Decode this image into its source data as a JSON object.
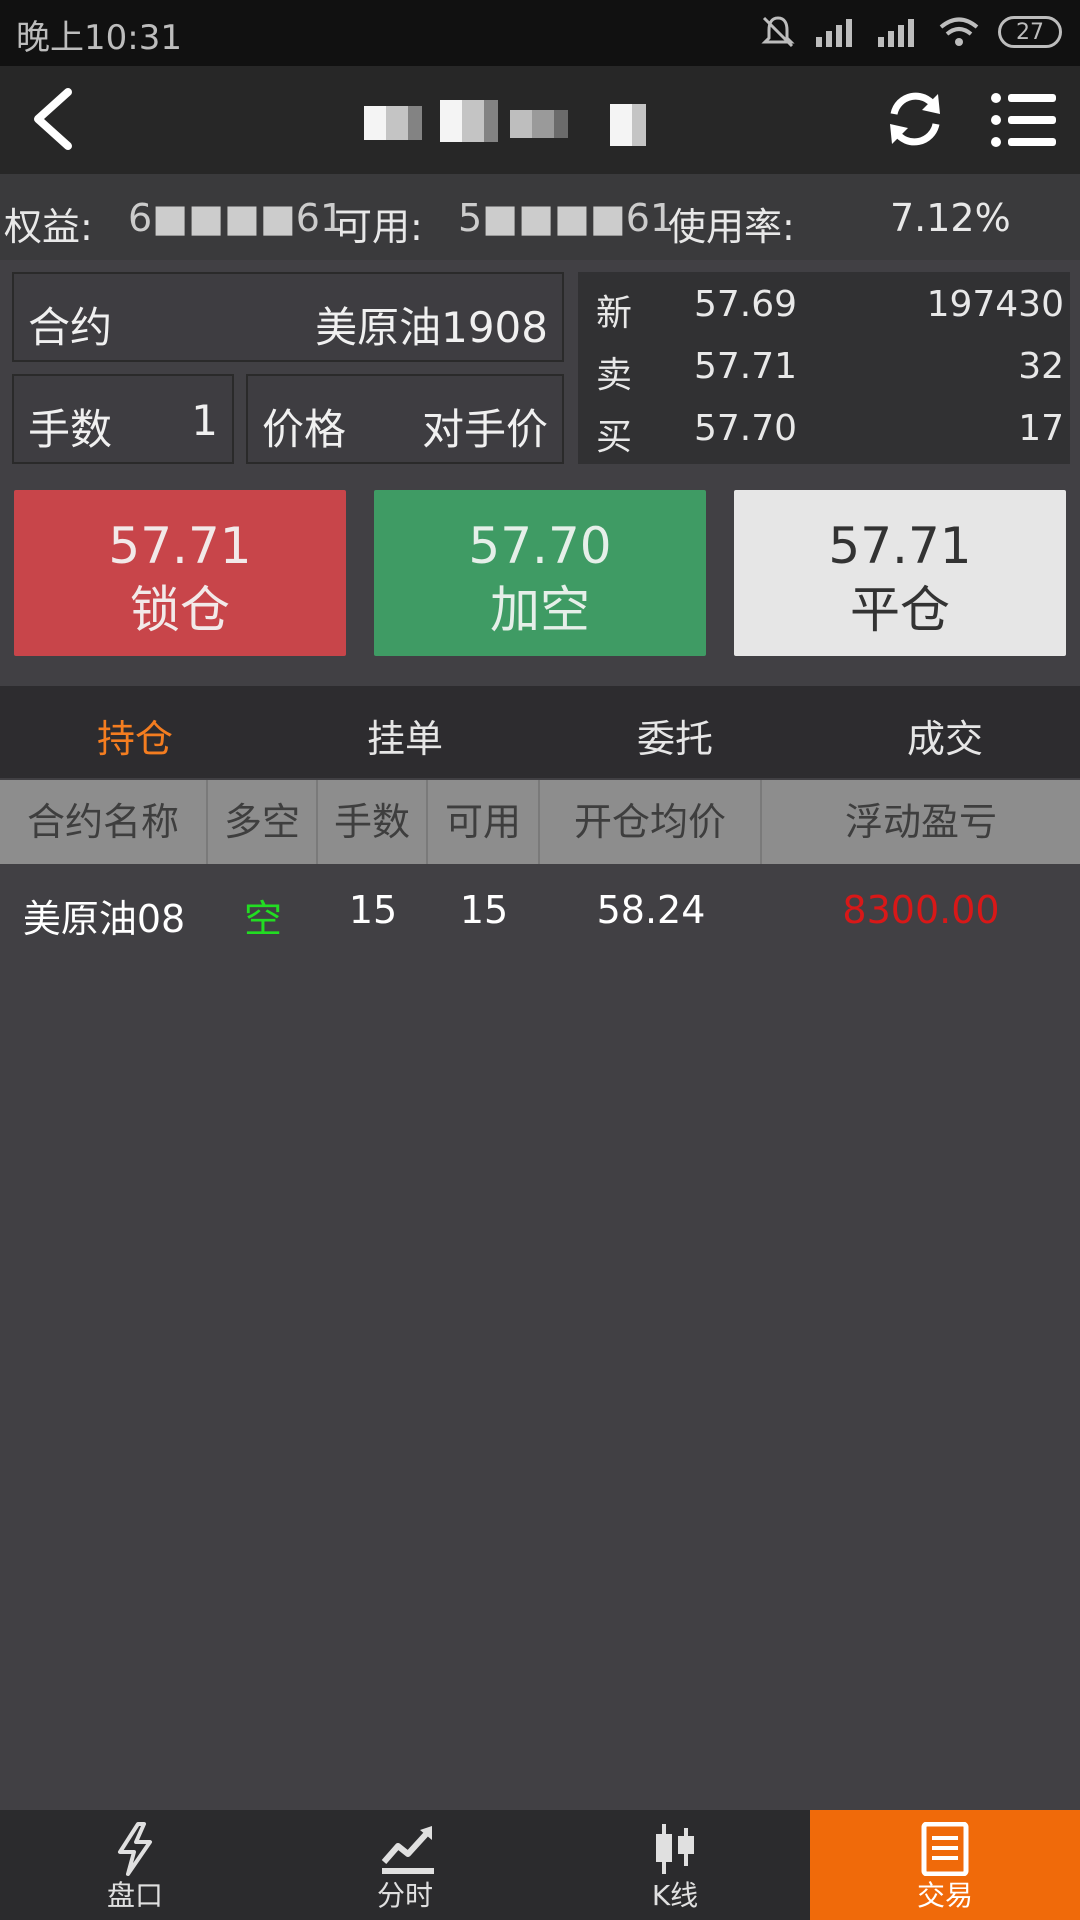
{
  "status_bar": {
    "time": "晚上10:31",
    "battery": "27"
  },
  "account": {
    "equity_label": "权益:",
    "equity_value": "6■■■■61",
    "available_label": "可用:",
    "available_value": "5■■■■61",
    "usage_label": "使用率:",
    "usage_value": "7.12%"
  },
  "order_form": {
    "contract_label": "合约",
    "contract_value": "美原油1908",
    "lots_label": "手数",
    "lots_value": "1",
    "price_label": "价格",
    "price_value": "对手价"
  },
  "quote": {
    "rows": [
      {
        "label": "新",
        "price": "57.69",
        "volume": "197430"
      },
      {
        "label": "卖",
        "price": "57.71",
        "volume": "32"
      },
      {
        "label": "买",
        "price": "57.70",
        "volume": "17"
      }
    ]
  },
  "actions": {
    "lock": {
      "price": "57.71",
      "label": "锁仓",
      "color": "#c8454a"
    },
    "short": {
      "price": "57.70",
      "label": "加空",
      "color": "#3f9b64"
    },
    "close": {
      "price": "57.71",
      "label": "平仓",
      "color": "#e6e6e6"
    }
  },
  "tabs": {
    "positions": "持仓",
    "pending": "挂单",
    "orders": "委托",
    "trades": "成交",
    "active_color": "#f47d20"
  },
  "table": {
    "headers": [
      "合约名称",
      "多空",
      "手数",
      "可用",
      "开仓均价",
      "浮动盈亏"
    ],
    "rows": [
      {
        "name": "美原油08",
        "direction": "空",
        "lots": "15",
        "available": "15",
        "avg_price": "58.24",
        "pnl": "8300.00"
      }
    ]
  },
  "nav": {
    "orderbook": "盘口",
    "intraday": "分时",
    "kline": "K线",
    "trade": "交易",
    "active_color": "#f06a0a"
  }
}
